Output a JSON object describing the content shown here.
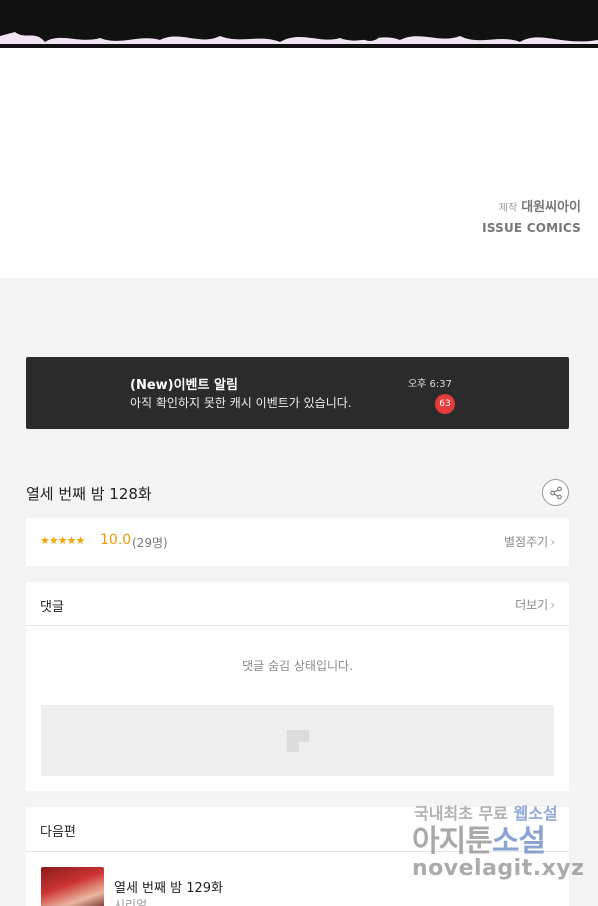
{
  "credit": {
    "label": "제작",
    "studio": "대원씨아이",
    "publisher": "ISSUE COMICS"
  },
  "event": {
    "title": "(New)이벤트 알림",
    "message": "아직 확인하지 못한 캐시 이벤트가 있습니다.",
    "time": "오후 6:37",
    "badge": "63"
  },
  "episode": {
    "title": "열세 번째 밤 128화"
  },
  "rating": {
    "stars": "★★★★★",
    "score": "10.0",
    "count": "(29명)",
    "rate_label": "별점주기"
  },
  "comments": {
    "title": "댓글",
    "more_label": "더보기",
    "hidden_message": "댓글 숨김 상태입니다."
  },
  "next": {
    "section_title": "다음편",
    "episode_title": "열세 번째 밤 129화",
    "genre": "시리얼"
  },
  "watermark": {
    "line1_a": "국내최초 무료",
    "line1_b": "웹소설",
    "line2_a": "아지툰",
    "line2_b": "소설",
    "line3": "novelagit.xyz"
  },
  "colors": {
    "accent_star": "#f0a400",
    "banner_bg": "#2b2b2b",
    "badge": "#e63b3b"
  }
}
